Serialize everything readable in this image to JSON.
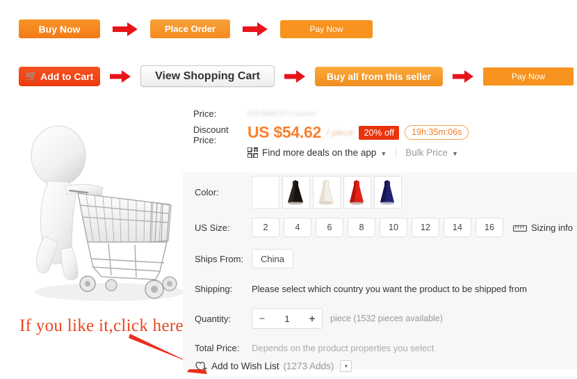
{
  "flow_row_1": [
    {
      "label": "Buy Now",
      "name": "buy-now-button"
    },
    {
      "label": "Place Order",
      "name": "place-order-button"
    },
    {
      "label": "Pay Now",
      "name": "pay-now-button"
    }
  ],
  "flow_row_2": [
    {
      "label": "Add to Cart",
      "name": "add-to-cart-button",
      "icon": "cart-icon"
    },
    {
      "label": "View Shopping Cart",
      "name": "view-shopping-cart-button"
    },
    {
      "label": "Buy all from this seller",
      "name": "buy-all-from-seller-button"
    },
    {
      "label": "Pay Now",
      "name": "pay-now-button-2"
    }
  ],
  "annotation": {
    "text": "If you like it,click here",
    "color": "#e8461e",
    "arrow": "red-arrow-pointing-to-wish-list"
  },
  "hero": {
    "alt": "3d-figure-pushing-shopping-cart"
  },
  "price": {
    "price_label": "Price:",
    "original_price": "US $68.27 / piece",
    "discount_label_line1": "Discount",
    "discount_label_line2": "Price:",
    "discount_price": "US $54.62",
    "unit": "/ piece",
    "off_badge": "20% off",
    "timer": "19h:35m:06s",
    "app_deals": "Find more deals on the app",
    "bulk_price": "Bulk Price",
    "accent_orange": "#f7812c",
    "badge_red": "#e8330c"
  },
  "properties": {
    "color": {
      "label": "Color:",
      "swatches": [
        {
          "name": "swatch-empty",
          "color": "#ffffff"
        },
        {
          "name": "swatch-black",
          "color": "#17130f"
        },
        {
          "name": "swatch-ivory",
          "color": "#f2ece1"
        },
        {
          "name": "swatch-red",
          "color": "#e01f16"
        },
        {
          "name": "swatch-navy",
          "color": "#1d1f6e"
        }
      ]
    },
    "us_size": {
      "label": "US Size:",
      "options": [
        "2",
        "4",
        "6",
        "8",
        "10",
        "12",
        "14",
        "16"
      ],
      "sizing_info": "Sizing info"
    },
    "ships_from": {
      "label": "Ships From:",
      "value": "China"
    },
    "shipping": {
      "label": "Shipping:",
      "note": "Please select which country you want the product to be shipped from"
    },
    "quantity": {
      "label": "Quantity:",
      "minus": "−",
      "value": "1",
      "plus": "+",
      "availability": "piece (1532 pieces available)"
    },
    "total_price": {
      "label": "Total Price:",
      "note": "Depends on the product properties you select"
    }
  },
  "wish_list": {
    "label": "Add to Wish List",
    "count": "(1273 Adds)",
    "caret": "▾"
  }
}
